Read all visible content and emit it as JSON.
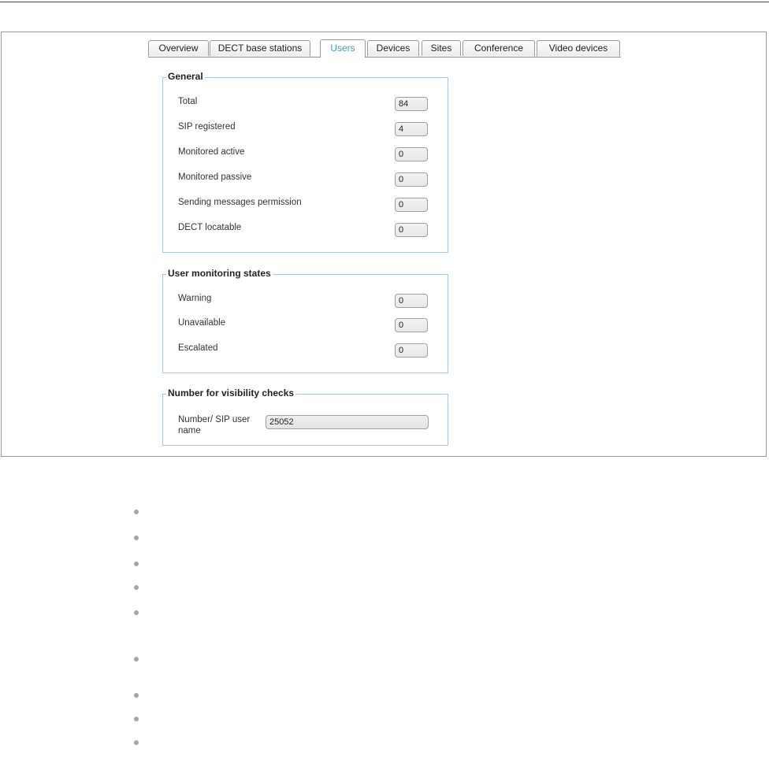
{
  "tabs": [
    {
      "label": "Overview",
      "active": false
    },
    {
      "label": "DECT base stations",
      "active": false
    },
    {
      "label": "Users",
      "active": true
    },
    {
      "label": "Devices",
      "active": false
    },
    {
      "label": "Sites",
      "active": false
    },
    {
      "label": "Conference",
      "active": false
    },
    {
      "label": "Video devices",
      "active": false
    }
  ],
  "general": {
    "legend": "General",
    "rows": [
      {
        "label": "Total",
        "value": "84"
      },
      {
        "label": "SIP registered",
        "value": "4"
      },
      {
        "label": "Monitored active",
        "value": "0"
      },
      {
        "label": "Monitored passive",
        "value": "0"
      },
      {
        "label": "Sending messages permission",
        "value": "0"
      },
      {
        "label": "DECT locatable",
        "value": "0"
      }
    ]
  },
  "monitoring": {
    "legend": "User monitoring states",
    "rows": [
      {
        "label": "Warning",
        "value": "0"
      },
      {
        "label": "Unavailable",
        "value": "0"
      },
      {
        "label": "Escalated",
        "value": "0"
      }
    ]
  },
  "visibility": {
    "legend": "Number for visibility checks",
    "label": "Number/ SIP user name",
    "value": "25052"
  },
  "colors": {
    "active_tab_text": "#3a9ad4",
    "fieldset_border": "#a9c8df",
    "bullet": "#a6a6a6"
  }
}
